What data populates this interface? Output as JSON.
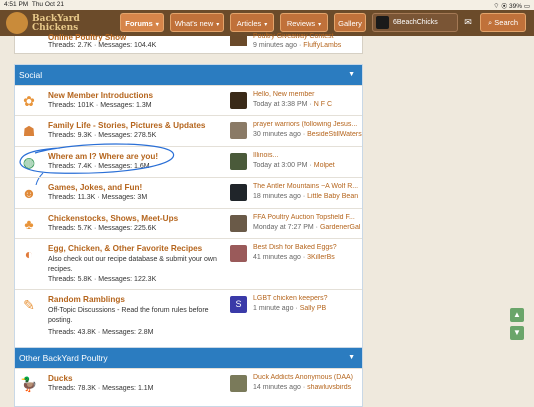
{
  "status_bar": {
    "time": "4:51 PM",
    "date": "Thu Oct 21",
    "battery": "39%"
  },
  "site": {
    "logo_line1": "BackYard",
    "logo_line2": "Chickens"
  },
  "nav": {
    "items": [
      {
        "label": "Forums"
      },
      {
        "label": "What's new"
      },
      {
        "label": "Articles"
      },
      {
        "label": "Reviews"
      },
      {
        "label": "Gallery"
      }
    ],
    "username": "6BeachChicks",
    "search_label": "Search"
  },
  "top_node": {
    "title": "Online Poultry Show",
    "threads": "2.7K",
    "messages": "104.4K",
    "latest_title": "Poultry Giveaway Contest",
    "latest_time": "9 minutes ago",
    "latest_user": "FluffyLambs"
  },
  "labels": {
    "threads": "Threads:",
    "messages": "Messages:",
    "sep": "·"
  },
  "social": {
    "title": "Social",
    "forums": [
      {
        "title": "New Member Introductions",
        "threads": "101K",
        "messages": "1.3M",
        "latest_title": "Hello, New member",
        "latest_time": "Today at 3:38 PM",
        "latest_user": "N F C"
      },
      {
        "title": "Family Life - Stories, Pictures & Updates",
        "threads": "9.3K",
        "messages": "278.5K",
        "latest_title": "prayer warriors (following Jesus...",
        "latest_time": "30 minutes ago",
        "latest_user": "BesideStillWaters"
      },
      {
        "title": "Where am I? Where are you!",
        "threads": "7.4K",
        "messages": "1.6M",
        "latest_title": "Illinois...",
        "latest_time": "Today at 3:00 PM",
        "latest_user": "Molpet"
      },
      {
        "title": "Games, Jokes, and Fun!",
        "threads": "11.3K",
        "messages": "3M",
        "latest_title": "The Antler Mountains ~A Wolf R...",
        "latest_time": "18 minutes ago",
        "latest_user": "Little Baby Bean"
      },
      {
        "title": "Chickenstocks, Shows, Meet-Ups",
        "threads": "5.7K",
        "messages": "225.6K",
        "latest_title": "FFA Poultry Auction Topsfield F...",
        "latest_time": "Monday at 7:27 PM",
        "latest_user": "GardenerGal"
      },
      {
        "title": "Egg, Chicken, & Other Favorite Recipes",
        "desc": "Also check out our recipe database & submit your own recipes.",
        "threads": "5.8K",
        "messages": "122.3K",
        "latest_title": "Best Dish for Baked Eggs?",
        "latest_time": "41 minutes ago",
        "latest_user": "3KillerBs"
      },
      {
        "title": "Random Ramblings",
        "desc": "Off-Topic Discussions - Read the forum rules before posting.",
        "threads": "43.8K",
        "messages": "2.8M",
        "latest_title": "LGBT chicken keepers?",
        "latest_time": "1 minute ago",
        "latest_user": "Sally PB",
        "latest_avatar_letter": "S"
      }
    ]
  },
  "other_poultry": {
    "title": "Other BackYard Poultry",
    "forums": [
      {
        "title": "Ducks",
        "threads": "78.3K",
        "messages": "1.1M",
        "latest_title": "Duck Addicts Anonymous (DAA)",
        "latest_time": "14 minutes ago",
        "latest_user": "shawluvsbirds"
      }
    ]
  },
  "colors": {
    "accent": "#2b7cc0",
    "link": "#b5651d",
    "nav_bg": "#6b4b2a",
    "nav_button": "#c0713a"
  }
}
